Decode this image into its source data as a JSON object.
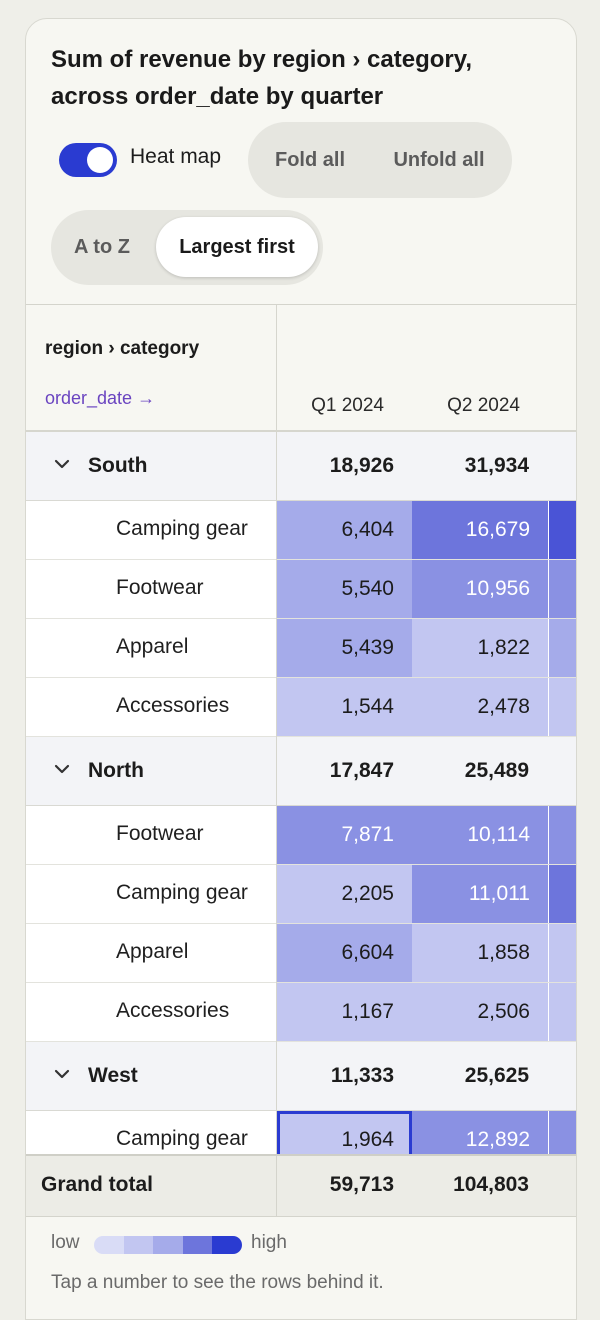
{
  "title": "Sum of revenue by region › category, across order_date by quarter",
  "controls": {
    "heatmap_label": "Heat map",
    "heatmap_on": true,
    "fold_all": "Fold all",
    "unfold_all": "Unfold all",
    "sort_az": "A to Z",
    "sort_largest": "Largest first",
    "sort_selected": "Largest first"
  },
  "table": {
    "row_header": "region › category",
    "column_axis": "order_date →",
    "columns": [
      "Q1 2024",
      "Q2 2024"
    ],
    "groups": [
      {
        "name": "South",
        "totals": [
          "18,926",
          "31,934"
        ],
        "rows": [
          {
            "label": "Camping gear",
            "values": [
              "6,404",
              "16,679"
            ],
            "levels": [
              2,
              4
            ],
            "extra_level": 5
          },
          {
            "label": "Footwear",
            "values": [
              "5,540",
              "10,956"
            ],
            "levels": [
              2,
              3
            ],
            "extra_level": 3
          },
          {
            "label": "Apparel",
            "values": [
              "5,439",
              "1,822"
            ],
            "levels": [
              2,
              1
            ],
            "extra_level": 2
          },
          {
            "label": "Accessories",
            "values": [
              "1,544",
              "2,478"
            ],
            "levels": [
              1,
              1
            ],
            "extra_level": 1
          }
        ]
      },
      {
        "name": "North",
        "totals": [
          "17,847",
          "25,489"
        ],
        "rows": [
          {
            "label": "Footwear",
            "values": [
              "7,871",
              "10,114"
            ],
            "levels": [
              3,
              3
            ],
            "extra_level": 3
          },
          {
            "label": "Camping gear",
            "values": [
              "2,205",
              "11,011"
            ],
            "levels": [
              1,
              3
            ],
            "extra_level": 4
          },
          {
            "label": "Apparel",
            "values": [
              "6,604",
              "1,858"
            ],
            "levels": [
              2,
              1
            ],
            "extra_level": 1
          },
          {
            "label": "Accessories",
            "values": [
              "1,167",
              "2,506"
            ],
            "levels": [
              1,
              1
            ],
            "extra_level": 1
          }
        ]
      },
      {
        "name": "West",
        "totals": [
          "11,333",
          "25,625"
        ],
        "rows": [
          {
            "label": "Camping gear",
            "values": [
              "1,964",
              "12,892"
            ],
            "levels": [
              1,
              3
            ],
            "extra_level": 3,
            "selected": 0
          }
        ]
      }
    ],
    "grand_total_label": "Grand total",
    "grand_totals": [
      "59,713",
      "104,803"
    ]
  },
  "heat_colors": [
    "#d9dcf6",
    "#c2c6f1",
    "#a5abea",
    "#8a91e3",
    "#6d75dc",
    "#4a54d6",
    "#2a3bd1"
  ],
  "legend": {
    "low": "low",
    "high": "high"
  },
  "hint": "Tap a number to see the rows behind it."
}
